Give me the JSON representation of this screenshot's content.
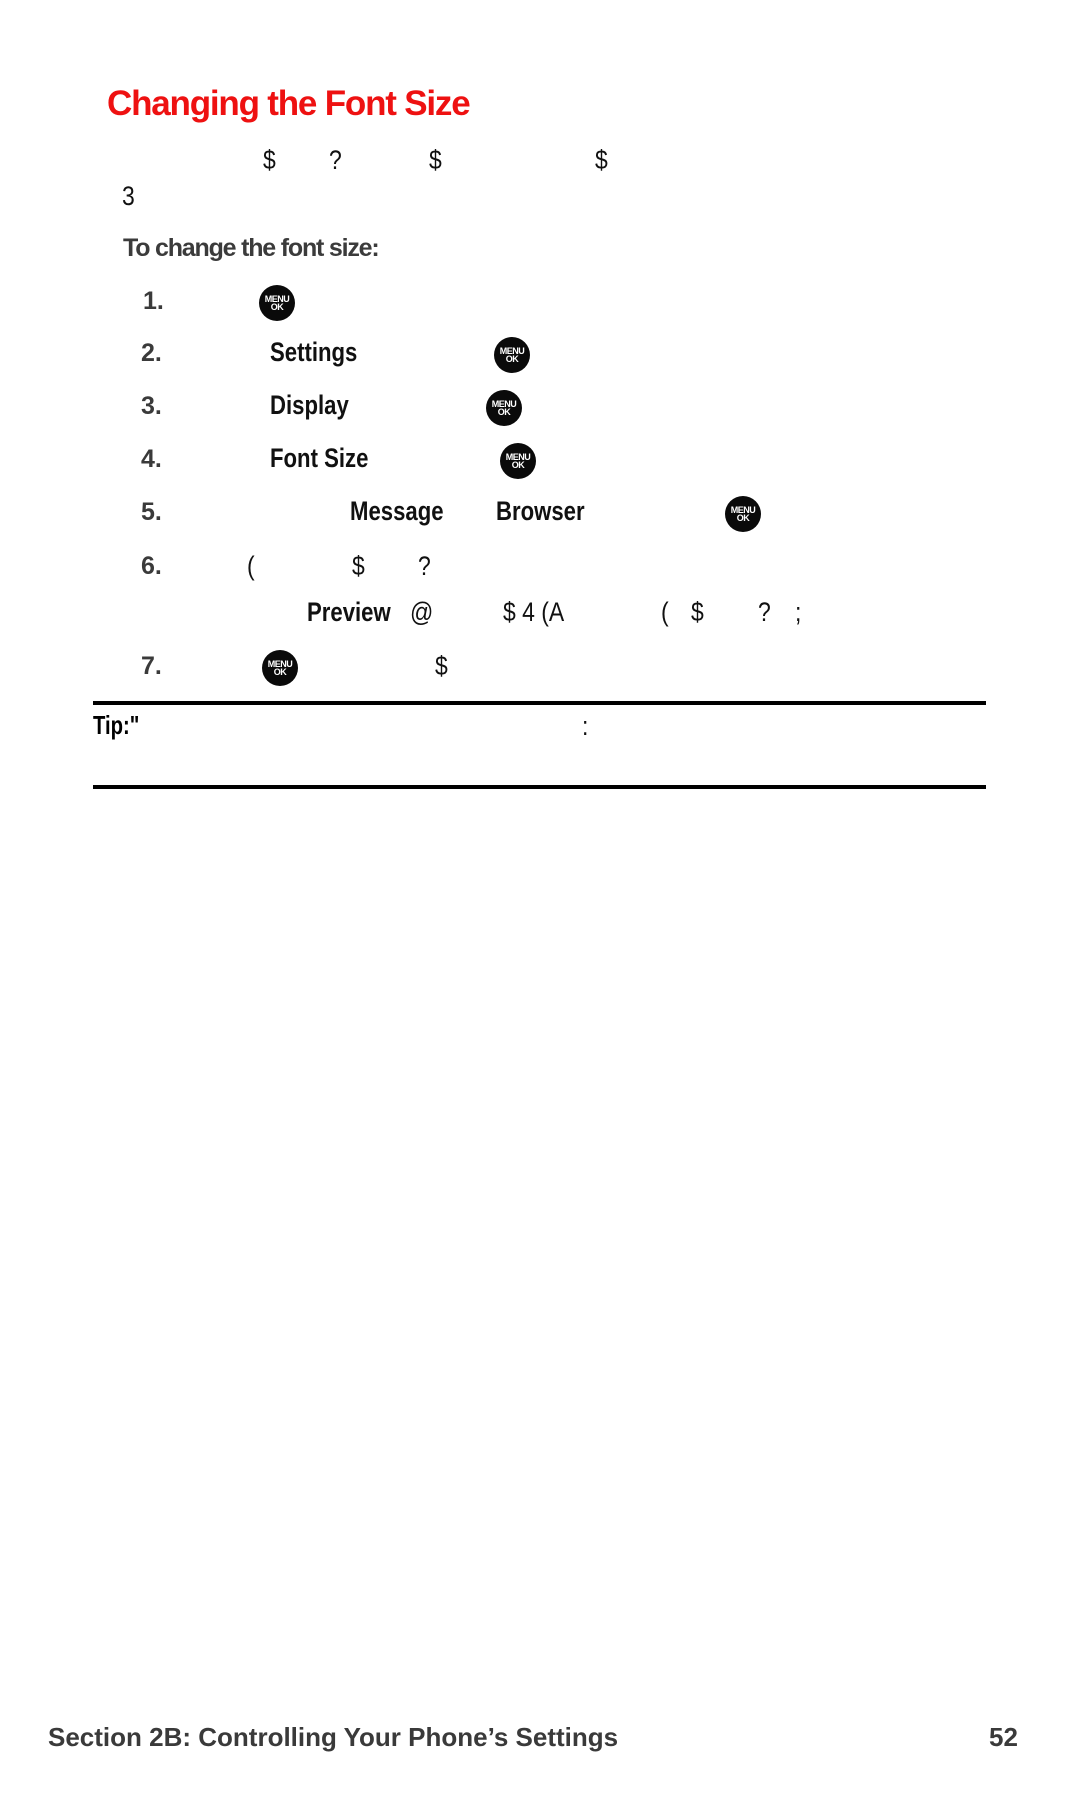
{
  "page": {
    "title": "Changing the Font Size",
    "intro": {
      "line1_glyphs": [
        "$",
        "?",
        "$",
        "$"
      ],
      "line2_glyphs": [
        "3"
      ]
    },
    "procedure_heading": "To change the font size:",
    "steps": [
      {
        "number": "1.",
        "icon": "menu-ok-icon"
      },
      {
        "number": "2.",
        "term": "Settings",
        "icon": "menu-ok-icon"
      },
      {
        "number": "3.",
        "term": "Display",
        "icon": "menu-ok-icon"
      },
      {
        "number": "4.",
        "term": "Font Size",
        "icon": "menu-ok-icon"
      },
      {
        "number": "5.",
        "terms": [
          "Message",
          "Browser"
        ],
        "icon": "menu-ok-icon"
      },
      {
        "number": "6.",
        "glyphs": [
          "(",
          "$",
          "?"
        ],
        "continuation": {
          "term": "Preview",
          "glyphs": [
            "@",
            "$ 4 (A",
            "(",
            "$",
            "?",
            ";"
          ]
        }
      },
      {
        "number": "7.",
        "icon": "menu-ok-icon",
        "glyphs": [
          "$"
        ]
      }
    ],
    "menu_icon_text": {
      "top": "MENU",
      "bottom": "OK"
    },
    "tip": {
      "label": "Tip:\"",
      "glyphs": [
        ":"
      ]
    },
    "footer": {
      "section": "Section 2B: Controlling Your Phone’s Settings",
      "page_number": "52"
    },
    "colors": {
      "title": "#ee1111",
      "body": "#111111",
      "subtle": "#3a3a3a"
    }
  }
}
